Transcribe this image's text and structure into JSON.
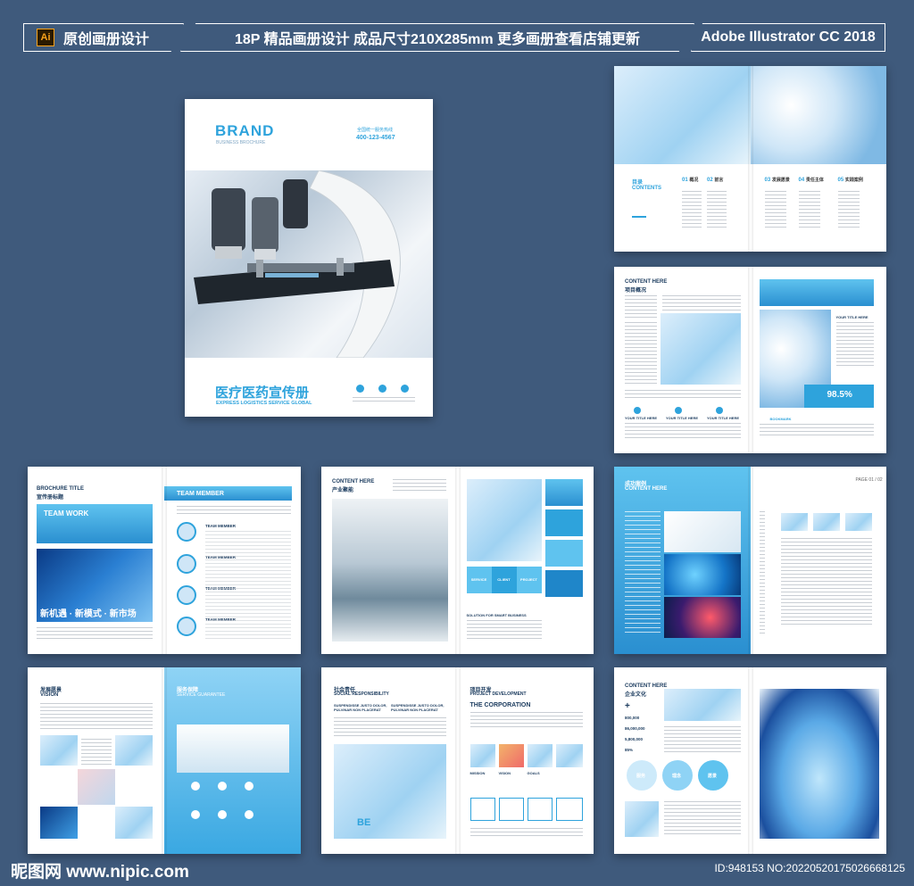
{
  "banner": {
    "ai_icon": "Ai",
    "left_label": "原创画册设计",
    "center_label": "18P 精品画册设计 成品尺寸210X285mm 更多画册查看店铺更新",
    "right_label": "Adobe Illustrator CC 2018"
  },
  "cover": {
    "brand": "BRAND",
    "brand_sub": "BUSINESS BROCHURE",
    "hotline_label": "全国统一服务热线",
    "hotline": "400-123-4567",
    "title_cn": "医疗医药宣传册",
    "title_en": "EXPRESS LOGISTICS SERVICE GLOBAL"
  },
  "contents": {
    "label_cn": "目录",
    "label_en": "CONTENTS",
    "items": [
      {
        "num": "01",
        "label": "概况"
      },
      {
        "num": "02",
        "label": "前言"
      },
      {
        "num": "03",
        "label": "发展愿景"
      },
      {
        "num": "04",
        "label": "责任主体"
      },
      {
        "num": "05",
        "label": "实践案例"
      }
    ]
  },
  "spread_about": {
    "heading_en": "CONTENT HERE",
    "heading_cn": "项目概况",
    "your_title": "YOUR TITLE HERE",
    "percent": "98.5%",
    "bookmark": "BOOKMARK",
    "cols": [
      "YOUR TITLE HERE",
      "YOUR TITLE HERE",
      "YOUR TITLE HERE"
    ]
  },
  "spread_team": {
    "title_en": "BROCHURE TITLE",
    "title_cn": "宣传册标题",
    "team_work": "TEAM WORK",
    "slogan": "新机遇 · 新模式 · 新市场",
    "team_header": "TEAM MEMBER",
    "members": [
      "TEAM MEMBER",
      "TEAM MEMBER",
      "TEAM MEMBER",
      "TEAM MEMBER"
    ]
  },
  "spread_industry": {
    "heading_en": "CONTENT HERE",
    "heading_cn": "产业聚能",
    "tiles": [
      "SERVICE",
      "CLIENT",
      "PROJECT"
    ],
    "solution": "SOLUTION FOR SMART BUSINESS"
  },
  "spread_cases": {
    "heading_cn": "成功案例",
    "heading_en": "CONTENT HERE",
    "page_num": "PAGE 01 / 02"
  },
  "spread_vision": {
    "heading_cn": "发展愿景",
    "heading_en": "VISION",
    "service_cn": "服务保障",
    "service_en": "SERVICE GUARANTEE"
  },
  "spread_social": {
    "heading_cn": "社会责任",
    "heading_en": "SOCIAL RESPONSIBILITY",
    "sub_a": "SUSPENDISSE JUSTO DOLOR, PULVINAR NON PLACERAT",
    "sub_b": "SUSPENDISSE JUSTO DOLOR, PULVINAR NON PLACERAT",
    "be": "BE",
    "project_cn": "项目开发",
    "project_en": "PROJECT DEVELOPMENT",
    "corp": "THE CORPORATION",
    "steps": [
      "MISSION",
      "VISION",
      "GOALS"
    ]
  },
  "spread_culture": {
    "heading_en": "CONTENT HERE",
    "heading_cn": "企业文化",
    "stats": [
      "800,000",
      "86,000,000",
      "5,800,000",
      "85%"
    ],
    "circles": [
      "服务",
      "理念",
      "愿景"
    ]
  },
  "footer": {
    "watermark": "昵图网 www.nipic.com",
    "id_text": "ID:948153 NO:20220520175026668125"
  }
}
